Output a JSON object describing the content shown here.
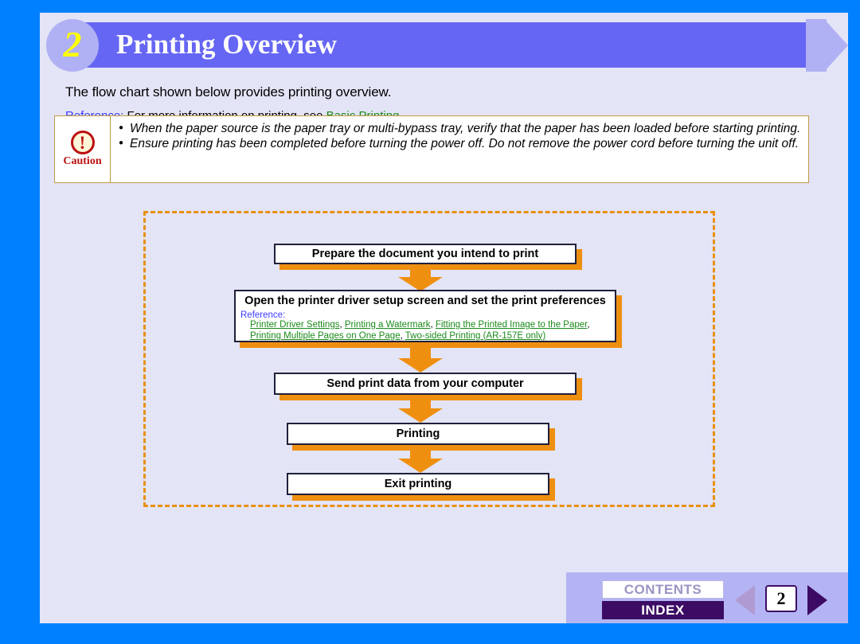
{
  "header": {
    "chapter_number": "2",
    "title": "Printing Overview"
  },
  "intro": {
    "line": "The flow chart shown below provides printing overview.",
    "reference_label": "Reference:",
    "reference_text": " For more information on printing, see ",
    "reference_link": "Basic Printing",
    "reference_period": "."
  },
  "caution": {
    "label": "Caution",
    "icon": "exclamation-circle-icon",
    "items": [
      "When the paper source is the paper tray or multi-bypass tray, verify that the paper has been loaded before starting printing.",
      "Ensure printing has been completed before turning the power off. Do not remove the power cord before turning the unit off."
    ]
  },
  "flowchart": {
    "steps": [
      {
        "title": "Prepare the document you intend to print"
      },
      {
        "title": "Open the printer driver setup screen and set the print preferences",
        "reference_label": "Reference:",
        "links_line1": [
          "Printer Driver Settings",
          "Printing a Watermark",
          "Fitting the Printed Image to the Paper"
        ],
        "links_line2": [
          "Printing Multiple Pages on One Page",
          "Two-sided Printing (AR-157E only)"
        ]
      },
      {
        "title": "Send print data from your computer"
      },
      {
        "title": "Printing"
      },
      {
        "title": "Exit printing"
      }
    ]
  },
  "nav": {
    "contents_label": "CONTENTS",
    "index_label": "INDEX",
    "page_number": "2",
    "prev_icon": "triangle-left-icon",
    "next_icon": "triangle-right-icon"
  },
  "colors": {
    "outer_frame": "#0080ff",
    "page_background": "#e4e4f7",
    "banner": "#6666f4",
    "banner_accent": "#b0b0f4",
    "chapter_number": "#ffff00",
    "flow_shadow": "#ef8f10",
    "flow_dashed_border": "#e8900c",
    "link_green": "#1a8a1a",
    "reference_blue": "#3a3aff",
    "caution_red": "#bb1111",
    "nav_panel": "#b4b4f4",
    "index_purple": "#3c0c64"
  }
}
